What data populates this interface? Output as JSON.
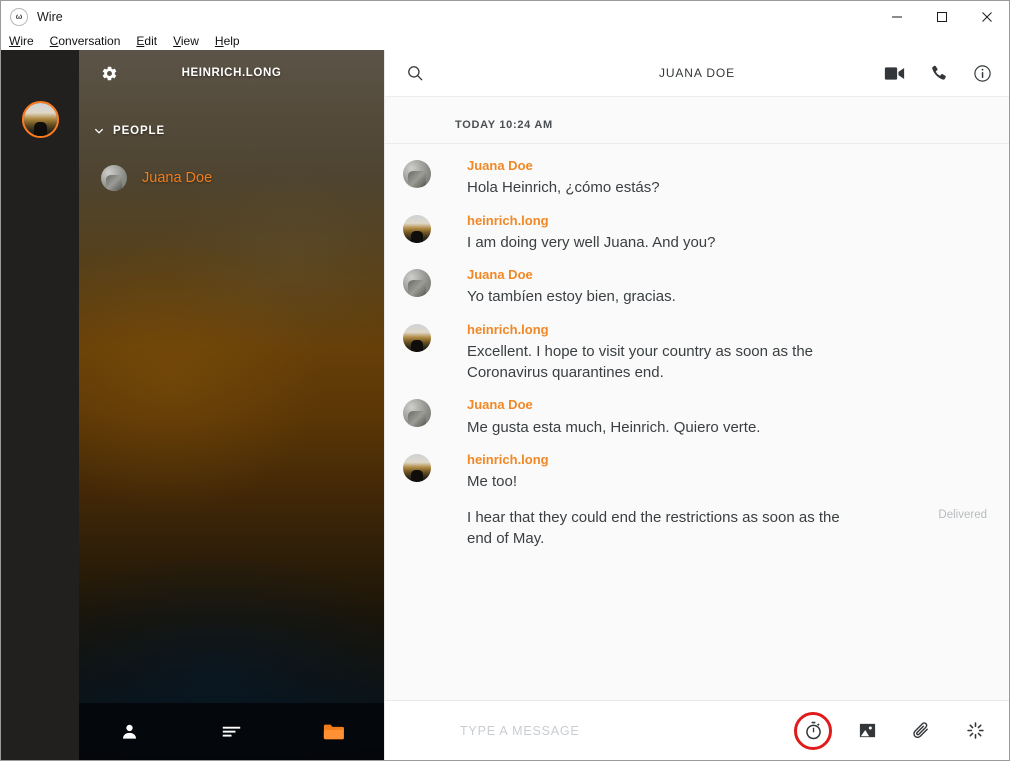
{
  "window": {
    "app_name": "Wire",
    "logo_glyph": "ω",
    "controls": {
      "minimize": "minimize-button",
      "maximize": "maximize-button",
      "close": "close-button"
    }
  },
  "menubar": {
    "items": [
      {
        "mnemonic": "W",
        "rest": "ire"
      },
      {
        "mnemonic": "C",
        "rest": "onversation"
      },
      {
        "mnemonic": "E",
        "rest": "dit"
      },
      {
        "mnemonic": "V",
        "rest": "iew"
      },
      {
        "mnemonic": "H",
        "rest": "elp"
      }
    ]
  },
  "sidebar": {
    "account_name": "HEINRICH.LONG",
    "section": {
      "label": "PEOPLE",
      "expanded": true
    },
    "conversations": [
      {
        "name": "Juana Doe",
        "avatar": "stone"
      }
    ],
    "footer_buttons": [
      {
        "name": "contacts-button",
        "icon": "person-icon"
      },
      {
        "name": "conversations-button",
        "icon": "list-icon"
      },
      {
        "name": "archive-button",
        "icon": "folder-icon"
      }
    ],
    "accent_color": "#f07c1a",
    "folder_color": "#f07c1a"
  },
  "conversation": {
    "title": "JUANA DOE",
    "search_icon": "search-icon",
    "actions": [
      {
        "name": "video-call-button",
        "icon": "video-camera-icon"
      },
      {
        "name": "voice-call-button",
        "icon": "phone-icon"
      },
      {
        "name": "conversation-info-button",
        "icon": "info-icon"
      }
    ],
    "day_separator": "TODAY 10:24 AM",
    "messages": [
      {
        "sender": "Juana Doe",
        "avatar": "stone",
        "continuation": false,
        "lines": [
          "Hola Heinrich, ¿cómo estás?"
        ],
        "status": ""
      },
      {
        "sender": "heinrich.long",
        "avatar": "landscape",
        "continuation": false,
        "lines": [
          "I am doing very well Juana. And you?"
        ],
        "status": ""
      },
      {
        "sender": "Juana Doe",
        "avatar": "stone",
        "continuation": false,
        "lines": [
          "Yo tambíen estoy bien, gracias."
        ],
        "status": ""
      },
      {
        "sender": "heinrich.long",
        "avatar": "landscape",
        "continuation": false,
        "lines": [
          "Excellent. I hope to visit your country as soon as the Coronavirus quarantines end."
        ],
        "status": ""
      },
      {
        "sender": "Juana Doe",
        "avatar": "stone",
        "continuation": false,
        "lines": [
          "Me gusta esta much, Heinrich. Quiero verte."
        ],
        "status": ""
      },
      {
        "sender": "heinrich.long",
        "avatar": "landscape",
        "continuation": false,
        "lines": [
          "Me too!"
        ],
        "status": ""
      },
      {
        "sender": "",
        "avatar": "",
        "continuation": true,
        "lines": [
          "I hear that they could end the restrictions as soon as the end of May."
        ],
        "status": "Delivered"
      }
    ]
  },
  "composer": {
    "placeholder": "TYPE A MESSAGE",
    "value": "",
    "actions": [
      {
        "name": "ephemeral-timer-button",
        "icon": "timer-icon",
        "highlighted": true
      },
      {
        "name": "add-image-button",
        "icon": "image-icon",
        "highlighted": false
      },
      {
        "name": "add-file-button",
        "icon": "paperclip-icon",
        "highlighted": false
      },
      {
        "name": "ping-button",
        "icon": "ping-icon",
        "highlighted": false
      }
    ],
    "highlight_color": "#e01b1b"
  }
}
